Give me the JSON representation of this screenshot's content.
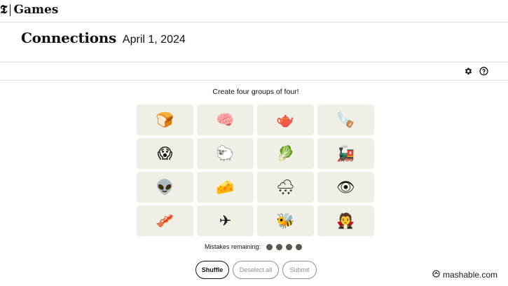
{
  "header": {
    "brand_logo": "𝕿",
    "brand_name": "Games"
  },
  "title_row": {
    "title": "Connections",
    "date": "April 1, 2024"
  },
  "toolbar": {
    "icons": [
      "gear-icon",
      "help-icon"
    ]
  },
  "game": {
    "instructions": "Create four groups of four!",
    "tiles": [
      {
        "emoji": "🍞",
        "name": "bread"
      },
      {
        "emoji": "🧠",
        "name": "brain"
      },
      {
        "emoji": "🫖",
        "name": "teapot"
      },
      {
        "emoji": "🪚",
        "name": "saw"
      },
      {
        "emoji": "😱",
        "name": "screaming-face"
      },
      {
        "emoji": "🐑",
        "name": "sheep"
      },
      {
        "emoji": "🥬",
        "name": "leafy-green"
      },
      {
        "emoji": "🚂",
        "name": "locomotive"
      },
      {
        "emoji": "👽",
        "name": "alien"
      },
      {
        "emoji": "🧀",
        "name": "cheese"
      },
      {
        "emoji": "🌨",
        "name": "snow-cloud"
      },
      {
        "emoji": "👁",
        "name": "eye"
      },
      {
        "emoji": "🥓",
        "name": "bacon"
      },
      {
        "emoji": "✈",
        "name": "airplane"
      },
      {
        "emoji": "🐝",
        "name": "bee"
      },
      {
        "emoji": "🧛",
        "name": "vampire"
      }
    ],
    "mistakes_label": "Mistakes remaining:",
    "mistakes_remaining": 4
  },
  "buttons": {
    "shuffle": "Shuffle",
    "deselect": "Deselect all",
    "submit": "Submit"
  },
  "watermark": {
    "text": "mashable.com"
  },
  "colors": {
    "tile_bg": "#efefe6",
    "dot": "#5a594e",
    "disabled": "#8f8f8f"
  }
}
